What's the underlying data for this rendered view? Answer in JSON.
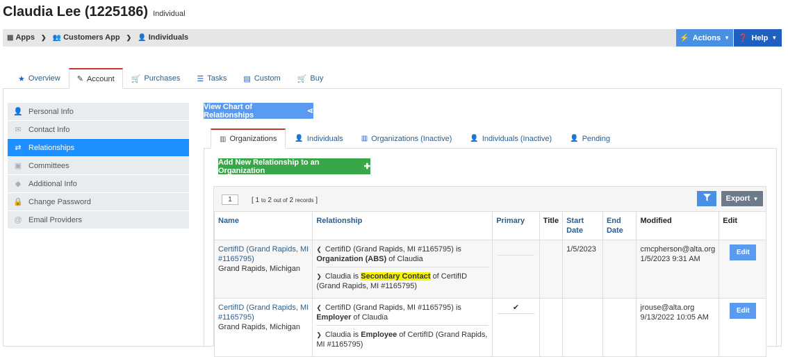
{
  "header": {
    "name": "Claudia Lee (1225186)",
    "type": "Individual"
  },
  "breadcrumb": {
    "apps": "Apps",
    "customers_app": "Customers App",
    "individuals": "Individuals"
  },
  "header_buttons": {
    "actions": "Actions",
    "help": "Help"
  },
  "tabs": [
    {
      "label": "Overview",
      "icon": "star-icon"
    },
    {
      "label": "Account",
      "icon": "edit-icon"
    },
    {
      "label": "Purchases",
      "icon": "cart-icon"
    },
    {
      "label": "Tasks",
      "icon": "tasks-icon"
    },
    {
      "label": "Custom",
      "icon": "file-icon"
    },
    {
      "label": "Buy",
      "icon": "cart-icon"
    }
  ],
  "sidenav": [
    {
      "label": "Personal Info",
      "icon": "user-icon"
    },
    {
      "label": "Contact Info",
      "icon": "envelope-icon"
    },
    {
      "label": "Relationships",
      "icon": "exchange-icon"
    },
    {
      "label": "Committees",
      "icon": "briefcase-icon"
    },
    {
      "label": "Additional Info",
      "icon": "tags-icon"
    },
    {
      "label": "Change Password",
      "icon": "lock-icon"
    },
    {
      "label": "Email Providers",
      "icon": "at-icon"
    }
  ],
  "chart_button": "View Chart of Relationships",
  "subtabs": [
    {
      "label": "Organizations",
      "icon": "building-icon"
    },
    {
      "label": "Individuals",
      "icon": "user-icon"
    },
    {
      "label": "Organizations (Inactive)",
      "icon": "building-icon"
    },
    {
      "label": "Individuals (Inactive)",
      "icon": "user-icon"
    },
    {
      "label": "Pending",
      "icon": "user-icon"
    }
  ],
  "add_button": "Add New Relationship to an Organization",
  "pager": {
    "page": "1",
    "range": "1",
    "to": "to",
    "end": "2",
    "out_of": "out of",
    "total": "2",
    "records": "records"
  },
  "export_button": "Export",
  "columns": {
    "name": "Name",
    "relationship": "Relationship",
    "primary": "Primary",
    "title": "Title",
    "start_date_1": "Start",
    "start_date_2": "Date",
    "end_date_1": "End",
    "end_date_2": "Date",
    "modified": "Modified",
    "edit": "Edit"
  },
  "rows": [
    {
      "name_link": "CertifID (Grand Rapids, MI #1165795)",
      "location": "Grand Rapids, Michigan",
      "rel1_pre": "CertifID (Grand Rapids, MI #1165795) is",
      "rel1_bold": "Organization (ABS)",
      "rel1_post": "of Claudia",
      "rel2_pre": "Claudia is",
      "rel2_bold": "Secondary Contact",
      "rel2_post": "of CertifID (Grand Rapids, MI #1165795)",
      "primary": "",
      "title": "",
      "start_date": "1/5/2023",
      "end_date": "",
      "modified_by": "cmcpherson@alta.org",
      "modified_at": "1/5/2023 9:31 AM",
      "edit": "Edit"
    },
    {
      "name_link": "CertifID (Grand Rapids, MI #1165795)",
      "location": "Grand Rapids, Michigan",
      "rel1_pre": "CertifID (Grand Rapids, MI #1165795) is",
      "rel1_bold": "Employer",
      "rel1_post": "of Claudia",
      "rel2_pre": "Claudia is",
      "rel2_bold": "Employee",
      "rel2_post": "of CertifID (Grand Rapids, MI #1165795)",
      "primary": "✔",
      "title": "",
      "start_date": "",
      "end_date": "",
      "modified_by": "jrouse@alta.org",
      "modified_at": "9/13/2022 10:05 AM",
      "edit": "Edit"
    }
  ]
}
